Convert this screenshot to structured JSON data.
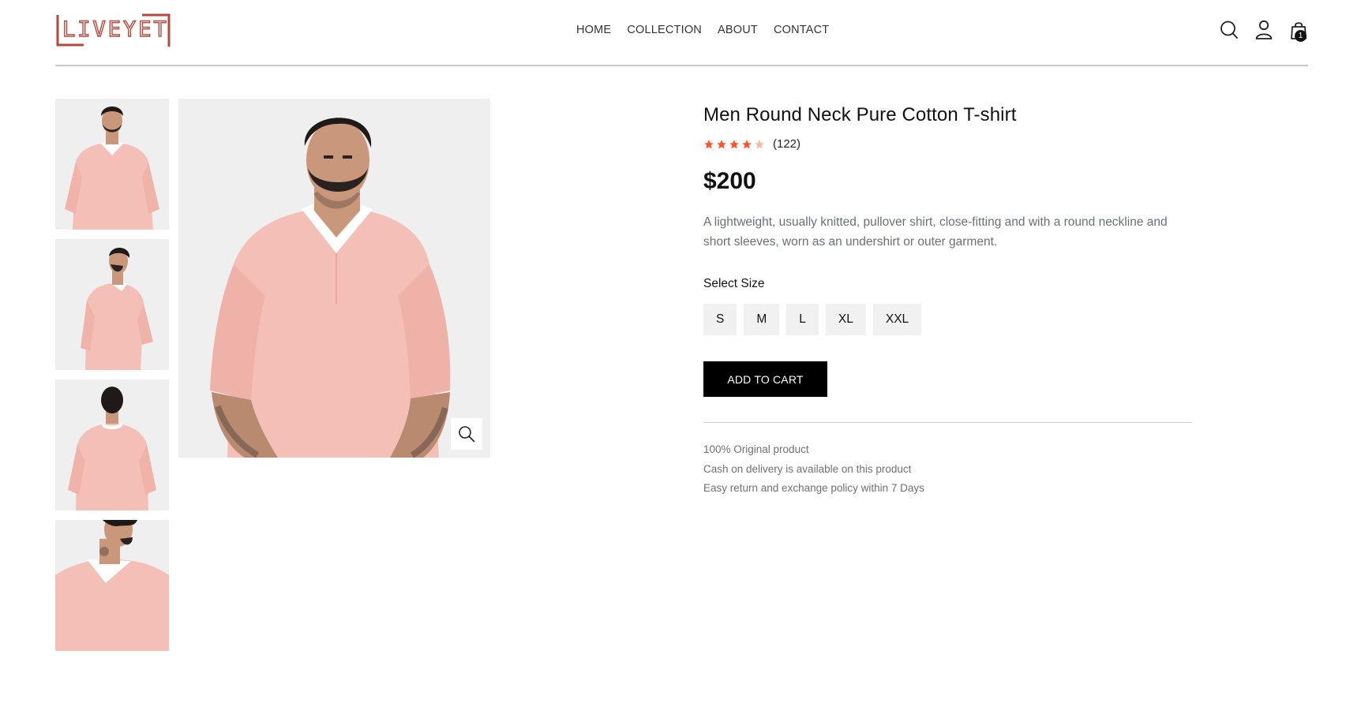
{
  "brand": {
    "logo_text": "LIVEYET",
    "logo_color": "#b5483d"
  },
  "nav": [
    {
      "label": "HOME"
    },
    {
      "label": "COLLECTION"
    },
    {
      "label": "ABOUT"
    },
    {
      "label": "CONTACT"
    }
  ],
  "header_icons": {
    "search": "search-icon",
    "profile": "profile-icon",
    "cart": "cart-icon",
    "cart_count": "1"
  },
  "gallery": {
    "thumbnails": [
      "front-view",
      "side-view",
      "back-view",
      "closeup-view"
    ],
    "zoom_icon": "zoom-icon",
    "shirt_color": "#f4bfb6"
  },
  "product": {
    "title": "Men Round Neck Pure Cotton T-shirt",
    "rating": 4,
    "rating_max": 5,
    "review_count": "(122)",
    "price": "$200",
    "description": "A lightweight, usually knitted, pullover shirt, close-fitting and with a round neckline and short sleeves, worn as an undershirt or outer garment.",
    "size_label": "Select Size",
    "sizes": [
      "S",
      "M",
      "L",
      "XL",
      "XXL"
    ],
    "add_to_cart": "ADD TO CART",
    "perks": [
      "100% Original product",
      "Cash on delivery is available on this product",
      "Easy return and exchange policy within 7 Days"
    ],
    "star_color": "#ff532e",
    "star_empty_color": "#f6b8ab"
  }
}
